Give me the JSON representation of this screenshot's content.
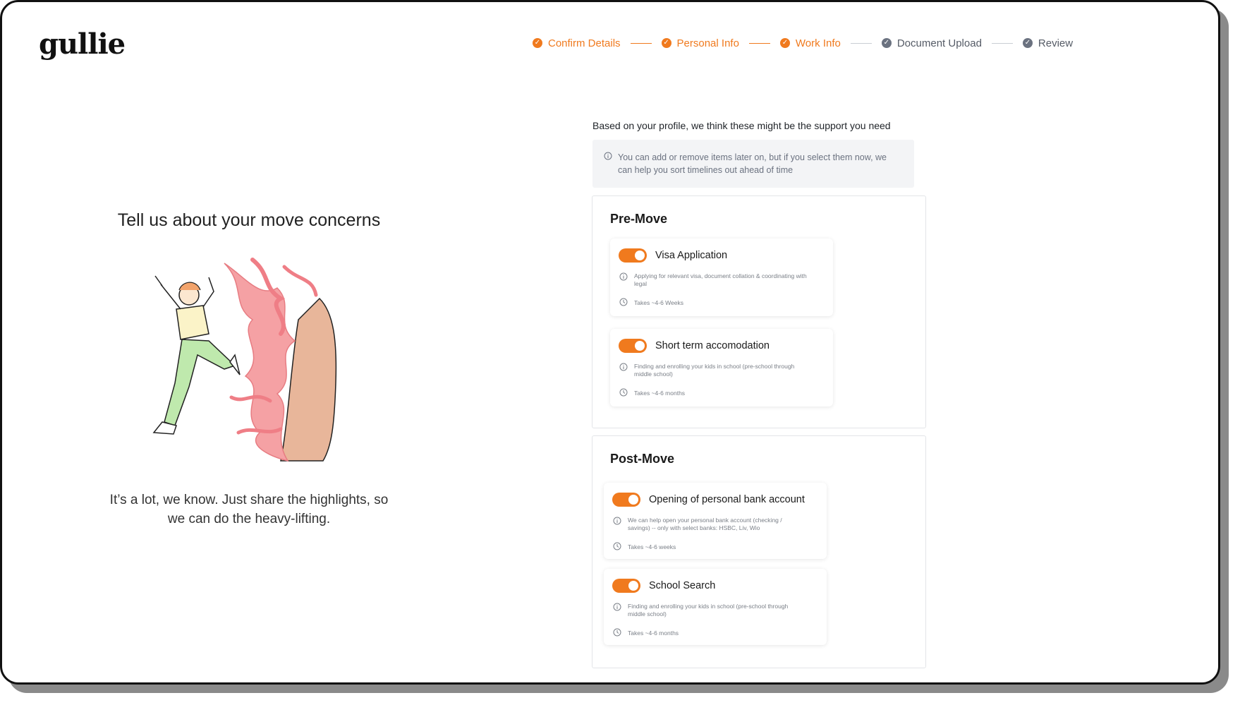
{
  "brand": {
    "logo": "gullie"
  },
  "stepper": {
    "steps": [
      {
        "label": "Confirm Details",
        "state": "done"
      },
      {
        "label": "Personal Info",
        "state": "done"
      },
      {
        "label": "Work Info",
        "state": "done"
      },
      {
        "label": "Document Upload",
        "state": "todo"
      },
      {
        "label": "Review",
        "state": "todo"
      }
    ]
  },
  "left": {
    "title": "Tell us about your move concerns",
    "subtitle": "It’s a lot, we know. Just share the highlights, so we can do the heavy-lifting."
  },
  "right": {
    "intro": "Based on your profile, we think these might be the support you need",
    "notice": "You can add or remove items later on, but if you select them now, we can help you sort timelines out ahead of time",
    "sections": [
      {
        "title": "Pre-Move",
        "items": [
          {
            "title": "Visa Application",
            "desc": "Applying for relevant visa, document collation & coordinating with legal",
            "time": "Takes ~4-6 Weeks",
            "enabled": true
          },
          {
            "title": "Short term accomodation",
            "desc": "Finding and enrolling your kids in school (pre-school through middle school)",
            "time": "Takes ~4-6 months",
            "enabled": true
          }
        ]
      },
      {
        "title": "Post-Move",
        "items": [
          {
            "title": "Opening of personal bank account",
            "desc": "We can help open your personal bank account (checking / savings) -- only with select banks: HSBC, Liv, Wio",
            "time": "Takes ~4-6 weeks",
            "enabled": true
          },
          {
            "title": "School Search",
            "desc": "Finding and enrolling your kids in school (pre-school through middle school)",
            "time": "Takes ~4-6 months",
            "enabled": true
          }
        ]
      }
    ]
  },
  "colors": {
    "accent": "#f07a1e",
    "muted": "#6b7280"
  }
}
